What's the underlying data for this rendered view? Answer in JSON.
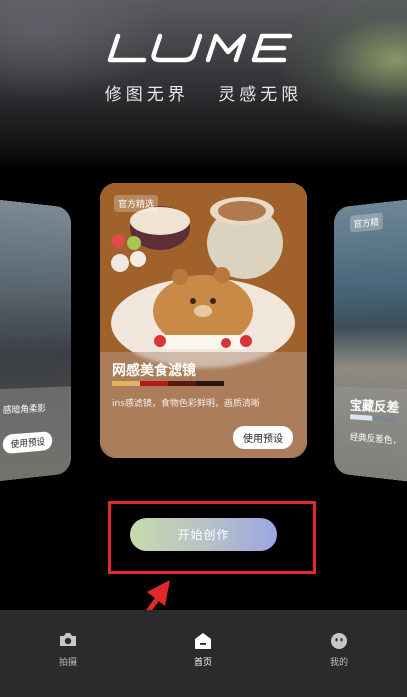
{
  "brand": {
    "logo_text": "LUME",
    "slogan_left": "修图无界",
    "slogan_right": "灵感无限"
  },
  "cards": {
    "main": {
      "tag": "官方精选",
      "title": "网感美食滤镜",
      "description": "ins感滤镜，食物色彩鲜明，画质清晰",
      "button": "使用预设",
      "swatches": [
        "#e3b15f",
        "#b41c1c",
        "#5a1a14",
        "#231614"
      ]
    },
    "left": {
      "description": "感暗角柔影",
      "button": "使用预设"
    },
    "right": {
      "tag": "官方精",
      "title": "宝藏反差",
      "description": "经典反差色，",
      "bars": [
        "#dce4ef",
        "#7c8791"
      ]
    }
  },
  "cta": {
    "label": "开始创作"
  },
  "tabbar": {
    "items": [
      {
        "label": "拍摄",
        "icon": "camera-icon"
      },
      {
        "label": "首页",
        "icon": "home-icon"
      },
      {
        "label": "我的",
        "icon": "profile-icon"
      }
    ],
    "active": "首页"
  },
  "colors": {
    "highlight": "#e02a2a",
    "tabbar_bg": "#2b2b2d"
  }
}
